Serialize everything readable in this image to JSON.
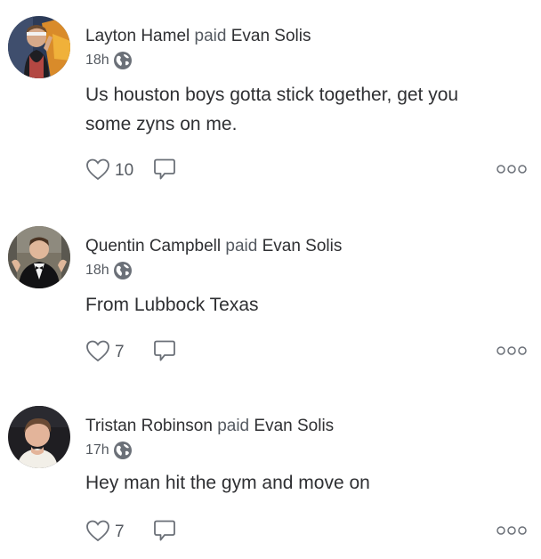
{
  "feed": {
    "stories": [
      {
        "actor": "Layton Hamel",
        "verb": "paid",
        "target": "Evan Solis",
        "time": "18h",
        "note_lines": [
          "Us houston boys gotta stick together, get you",
          "some zyns on me."
        ],
        "likes": "10"
      },
      {
        "actor": "Quentin Campbell",
        "verb": "paid",
        "target": "Evan Solis",
        "time": "18h",
        "note_lines": [
          "From Lubbock Texas"
        ],
        "likes": "7"
      },
      {
        "actor": "Tristan Robinson",
        "verb": "paid",
        "target": "Evan Solis",
        "time": "17h",
        "note_lines": [
          "Hey man hit the gym and move on"
        ],
        "likes": "7"
      }
    ]
  },
  "icons": {
    "privacy": "globe-icon",
    "like": "heart-icon",
    "comment": "comment-icon",
    "more": "more-icon"
  },
  "colors": {
    "text": "#2f3033",
    "muted": "#555a61",
    "icon": "#6b7078"
  }
}
